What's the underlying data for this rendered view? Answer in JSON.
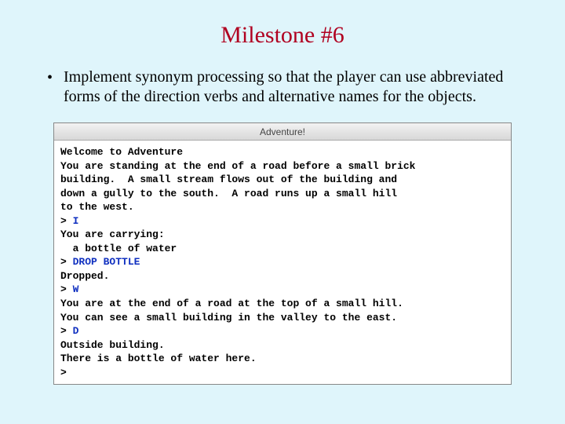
{
  "title": "Milestone #6",
  "bullet": "Implement synonym processing so that the player can use abbreviated forms of the direction verbs and alternative names for the objects.",
  "window_title": "Adventure!",
  "terminal": {
    "lines": [
      {
        "text": "Welcome to Adventure"
      },
      {
        "text": "You are standing at the end of a road before a small brick"
      },
      {
        "text": "building.  A small stream flows out of the building and"
      },
      {
        "text": "down a gully to the south.  A road runs up a small hill"
      },
      {
        "text": "to the west."
      },
      {
        "prompt": "> ",
        "input": "I"
      },
      {
        "text": "You are carrying:"
      },
      {
        "text": "  a bottle of water"
      },
      {
        "prompt": "> ",
        "input": "DROP BOTTLE"
      },
      {
        "text": "Dropped."
      },
      {
        "prompt": "> ",
        "input": "W"
      },
      {
        "text": "You are at the end of a road at the top of a small hill."
      },
      {
        "text": "You can see a small building in the valley to the east."
      },
      {
        "prompt": "> ",
        "input": "D"
      },
      {
        "text": "Outside building."
      },
      {
        "text": "There is a bottle of water here."
      },
      {
        "prompt": "> ",
        "input": ""
      }
    ]
  }
}
